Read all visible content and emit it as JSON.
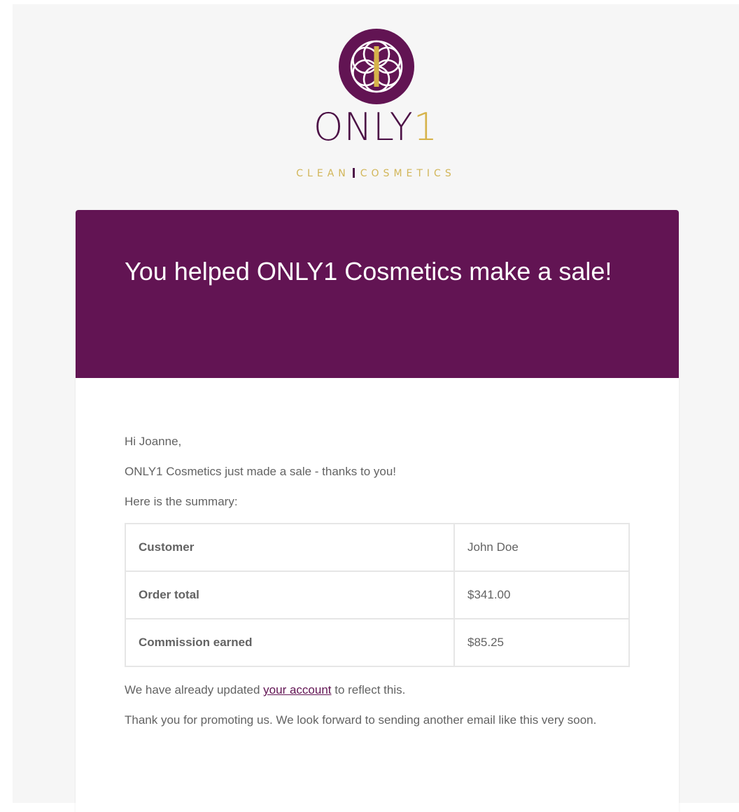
{
  "brand": {
    "name": "ONLY",
    "name_suffix": "1",
    "tagline_left": "CLEAN",
    "tagline_right": "COSMETICS",
    "primary_color": "#621453",
    "accent_color": "#d6b34a",
    "logo_icon": "flower-of-life-logo-icon"
  },
  "email": {
    "heading": "You helped ONLY1 Cosmetics make a sale!",
    "greeting": "Hi Joanne,",
    "intro": "ONLY1 Cosmetics just made a sale - thanks to you!",
    "summary_intro": "Here is the summary:",
    "summary_rows": [
      {
        "label": "Customer",
        "value": "John Doe"
      },
      {
        "label": "Order total",
        "value": "$341.00"
      },
      {
        "label": "Commission earned",
        "value": "$85.25"
      }
    ],
    "update_before": "We have already updated ",
    "update_link": "your account",
    "update_after": " to reflect this.",
    "closing": "Thank you for promoting us. We look forward to sending another email like this very soon."
  }
}
